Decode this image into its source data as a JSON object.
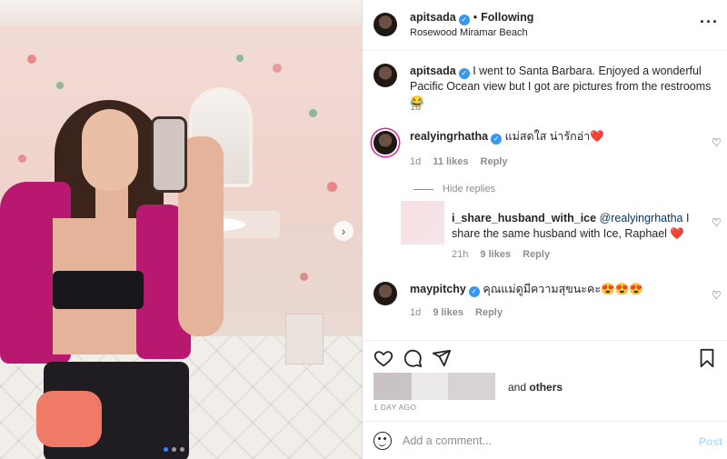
{
  "post": {
    "username": "apitsada",
    "follow_status": "Following",
    "location": "Rosewood Miramar Beach"
  },
  "caption": {
    "username": "apitsada",
    "text": "I went to Santa Barbara. Enjoyed a wonderful Pacific Ocean view but I got are pictures from the restrooms 😂",
    "time": "1d"
  },
  "comments": [
    {
      "username": "realyingrhatha",
      "text": "แม่สดใส น่ารักอ่า❤️",
      "time": "1d",
      "likes": "11 likes",
      "reply_label": "Reply"
    },
    {
      "username": "maypitchy",
      "text": "คุณแม่ดูมีความสุขนะคะ😍😍😍",
      "time": "1d",
      "likes": "9 likes",
      "reply_label": "Reply"
    }
  ],
  "hide_replies": "Hide replies",
  "reply": {
    "username": "i_share_husband_with_ice",
    "mention": "@realyingrhatha",
    "text": "I share the same husband with Ice, Raphael ❤️",
    "time": "21h",
    "likes": "9 likes",
    "reply_label": "Reply"
  },
  "likes_summary": {
    "suffix_and": "and",
    "suffix_others": "others"
  },
  "timestamp": "1 DAY AGO",
  "add_comment": {
    "placeholder": "Add a comment...",
    "post_label": "Post"
  },
  "icons": {
    "more": "more-options-icon",
    "heart": "heart-icon",
    "comment": "comment-icon",
    "share": "share-icon",
    "save": "bookmark-icon",
    "emoji": "emoji-icon",
    "next": "chevron-right-icon"
  },
  "colors": {
    "verified": "#3897f0",
    "post_button": "#b2dffc",
    "like_heart": "#e0245e",
    "link": "#00376b",
    "carousel_active_dot": "#2f8bf7"
  },
  "carousel": {
    "current": 1,
    "total": 3
  }
}
